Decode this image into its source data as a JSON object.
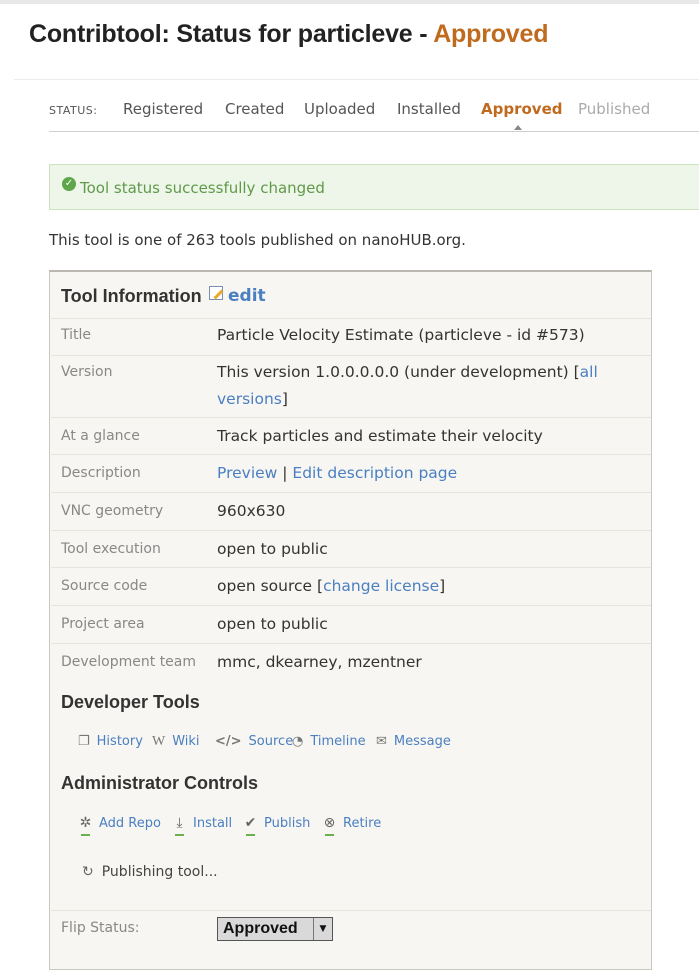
{
  "page": {
    "title_prefix": "Contribtool: Status for particleve - ",
    "title_status": "Approved"
  },
  "status_bar": {
    "label": "STATUS:",
    "steps": [
      "Registered",
      "Created",
      "Uploaded",
      "Installed",
      "Approved",
      "Published"
    ],
    "active": "Approved"
  },
  "notice": {
    "message": "Tool status successfully changed"
  },
  "intro": "This tool is one of 263 tools published on nanoHUB.org.",
  "tool_info": {
    "heading": "Tool Information",
    "edit_label": "edit",
    "rows": {
      "title": {
        "label": "Title",
        "value": "Particle Velocity Estimate (particleve - id #573)"
      },
      "version": {
        "label": "Version",
        "value_prefix": "This version 1.0.0.0.0.0 (under development) [",
        "link": "all versions",
        "value_suffix": "]"
      },
      "glance": {
        "label": "At a glance",
        "value": "Track particles and estimate their velocity"
      },
      "description": {
        "label": "Description",
        "link1": "Preview",
        "sep": " | ",
        "link2": "Edit description page"
      },
      "vnc": {
        "label": "VNC geometry",
        "value": "960x630"
      },
      "execution": {
        "label": "Tool execution",
        "value": "open to public"
      },
      "source": {
        "label": "Source code",
        "value_prefix": "open source [",
        "link": "change license",
        "value_suffix": "]"
      },
      "project": {
        "label": "Project area",
        "value": "open to public"
      },
      "team": {
        "label": "Development team",
        "value": "mmc, dkearney, mzentner"
      }
    }
  },
  "developer_tools": {
    "heading": "Developer Tools",
    "items": [
      {
        "label": "History",
        "icon": "history-icon"
      },
      {
        "label": "Wiki",
        "icon": "wiki-icon"
      },
      {
        "label": "Source",
        "icon": "source-code-icon"
      },
      {
        "label": "Timeline",
        "icon": "clock-icon"
      },
      {
        "label": "Message",
        "icon": "envelope-icon"
      }
    ]
  },
  "admin_controls": {
    "heading": "Administrator Controls",
    "items": [
      {
        "label": "Add Repo",
        "icon": "gear-icon"
      },
      {
        "label": "Install",
        "icon": "download-icon"
      },
      {
        "label": "Publish",
        "icon": "checkmark-icon"
      },
      {
        "label": "Retire",
        "icon": "x-circle-icon"
      }
    ],
    "progress_text": "Publishing tool..."
  },
  "flip_status": {
    "label": "Flip Status:",
    "selected": "Approved"
  },
  "colors": {
    "accent": "#c06a1d",
    "link": "#4a7fc1",
    "success": "#5f9a4a"
  }
}
